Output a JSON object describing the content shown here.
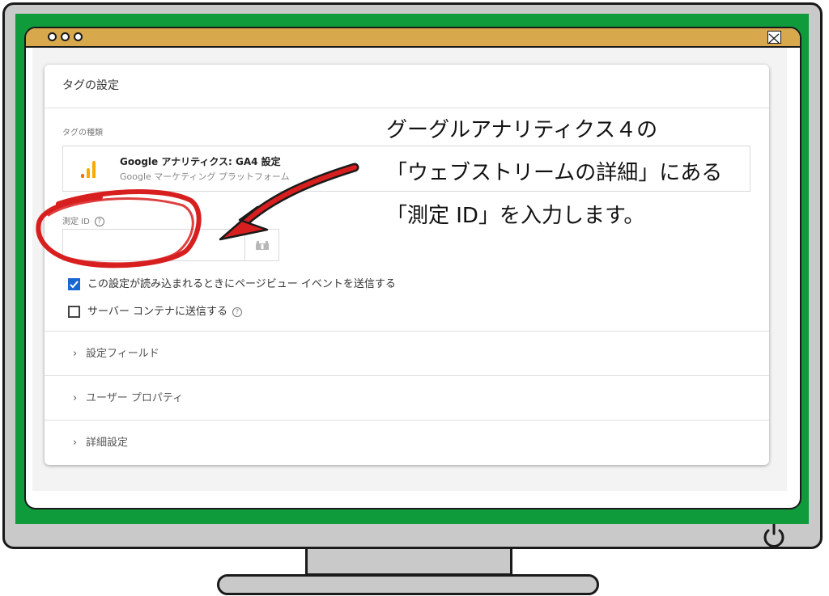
{
  "window": {
    "close_icon": "close-x-icon"
  },
  "card": {
    "title": "タグの設定",
    "tag_type_label": "タグの種類",
    "tag_type": {
      "name": "Google アナリティクス: GA4 設定",
      "vendor": "Google マーケティング プラットフォーム",
      "icon": "analytics-bars-icon"
    },
    "measurement_id_label": "測定 ID",
    "measurement_id_value": "",
    "variable_icon": "variable-brick-icon",
    "help_icon": "help-circle-icon",
    "checkbox_pageview": {
      "label": "この設定が読み込まれるときにページビュー イベントを送信する",
      "checked": true
    },
    "checkbox_server": {
      "label": "サーバー コンテナに送信する",
      "checked": false
    },
    "sections": [
      {
        "label": "設定フィールド"
      },
      {
        "label": "ユーザー プロパティ"
      },
      {
        "label": "詳細設定"
      }
    ]
  },
  "annotation": {
    "line1": "グーグルアナリティクス４の",
    "line2": "「ウェブストリームの詳細」にある",
    "line3": "「測定 ID」を入力します。",
    "arrow_color": "#d81f1f",
    "circle_color": "#d81f1f"
  },
  "colors": {
    "frame_green": "#0f9a3c",
    "titlebar": "#d8a84d",
    "checkbox_blue": "#1967d2",
    "ga_orange": "#f9ab00",
    "ga_orange_dark": "#e37400"
  },
  "power_icon": "power-icon"
}
